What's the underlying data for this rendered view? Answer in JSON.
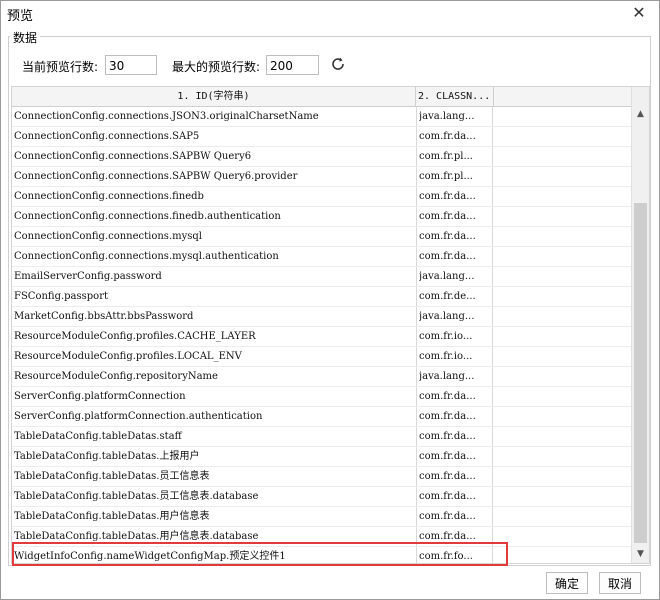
{
  "window": {
    "title": "预览",
    "close_symbol": "✕"
  },
  "group": {
    "legend": "数据"
  },
  "controls": {
    "current_rows_label": "当前预览行数:",
    "current_rows_value": "30",
    "max_rows_label": "最大的预览行数:",
    "max_rows_value": "200",
    "refresh_icon": "refresh-icon"
  },
  "table": {
    "columns": [
      "1. ID(字符串)",
      "2. CLASSN..."
    ],
    "rows": [
      [
        "ConnectionConfig.connections.JSON3.originalCharsetName",
        "java.lang..."
      ],
      [
        "ConnectionConfig.connections.SAP5",
        "com.fr.da..."
      ],
      [
        "ConnectionConfig.connections.SAPBW Query6",
        "com.fr.pl..."
      ],
      [
        "ConnectionConfig.connections.SAPBW Query6.provider",
        "com.fr.pl..."
      ],
      [
        "ConnectionConfig.connections.finedb",
        "com.fr.da..."
      ],
      [
        "ConnectionConfig.connections.finedb.authentication",
        "com.fr.da..."
      ],
      [
        "ConnectionConfig.connections.mysql",
        "com.fr.da..."
      ],
      [
        "ConnectionConfig.connections.mysql.authentication",
        "com.fr.da..."
      ],
      [
        "EmailServerConfig.password",
        "java.lang..."
      ],
      [
        "FSConfig.passport",
        "com.fr.de..."
      ],
      [
        "MarketConfig.bbsAttr.bbsPassword",
        "java.lang..."
      ],
      [
        "ResourceModuleConfig.profiles.CACHE_LAYER",
        "com.fr.io..."
      ],
      [
        "ResourceModuleConfig.profiles.LOCAL_ENV",
        "com.fr.io..."
      ],
      [
        "ResourceModuleConfig.repositoryName",
        "java.lang..."
      ],
      [
        "ServerConfig.platformConnection",
        "com.fr.da..."
      ],
      [
        "ServerConfig.platformConnection.authentication",
        "com.fr.da..."
      ],
      [
        "TableDataConfig.tableDatas.staff",
        "com.fr.da..."
      ],
      [
        "TableDataConfig.tableDatas.上报用户",
        "com.fr.da..."
      ],
      [
        "TableDataConfig.tableDatas.员工信息表",
        "com.fr.da..."
      ],
      [
        "TableDataConfig.tableDatas.员工信息表.database",
        "com.fr.da..."
      ],
      [
        "TableDataConfig.tableDatas.用户信息表",
        "com.fr.da..."
      ],
      [
        "TableDataConfig.tableDatas.用户信息表.database",
        "com.fr.da..."
      ],
      [
        "WidgetInfoConfig.nameWidgetConfigMap.预定义控件1",
        "com.fr.fo..."
      ]
    ]
  },
  "highlight_color": "#e23a3a",
  "buttons": {
    "ok": "确定",
    "cancel": "取消"
  }
}
